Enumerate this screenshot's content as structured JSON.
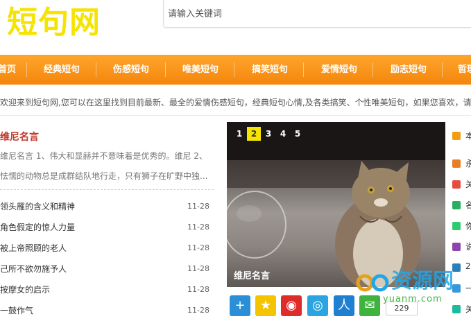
{
  "header": {
    "logo": "短句网",
    "search_placeholder": "请输入关键词"
  },
  "nav": {
    "items": [
      "首页",
      "经典短句",
      "伤感短句",
      "唯美短句",
      "搞笑短句",
      "爱情短句",
      "励志短句",
      "哲理"
    ]
  },
  "marquee": "欢迎来到短句网,您可以在这里找到目前最新、最全的爱情伤感短句，经典短句心情,及各类搞笑、个性唯美短句，如果您喜欢，请收",
  "featured": {
    "title": "维尼名言",
    "desc_line1": "维尼名言 1、伟大和显赫并不意味着是优秀的。维尼 2、",
    "desc_line2": "怯懦的动物总是成群结队地行走，只有狮子在旷野中独..."
  },
  "articles": [
    {
      "title": "领头雁的含义和精神",
      "date": "11-28"
    },
    {
      "title": "角色假定的惊人力量",
      "date": "11-28"
    },
    {
      "title": "被上帝照顾的老人",
      "date": "11-28"
    },
    {
      "title": "己所不欲勿施予人",
      "date": "11-28"
    },
    {
      "title": "按摩女的启示",
      "date": "11-28"
    },
    {
      "title": "一鼓作气",
      "date": "11-28"
    }
  ],
  "slider": {
    "pages": [
      "1",
      "2",
      "3",
      "4",
      "5"
    ],
    "active_page": "2",
    "caption": "维尼名言"
  },
  "share": {
    "count": "229",
    "icons": [
      "plus-icon",
      "qzone-star-icon",
      "weibo-icon",
      "tencent-weibo-icon",
      "renren-icon",
      "wechat-icon"
    ]
  },
  "right_list": {
    "items": [
      "本",
      "永",
      "关",
      "名",
      "你",
      "说",
      "2",
      "一",
      "关"
    ],
    "colors": [
      "#f39c12",
      "#e67e22",
      "#e74c3c",
      "#27ae60",
      "#2ecc71",
      "#8e44ad",
      "#2980b9",
      "#3498db",
      "#1abc9c"
    ]
  },
  "watermark": {
    "text": "资源网",
    "domain": "yuanm.com"
  },
  "colors": {
    "nav_bg": "#f4860c",
    "logo": "#f5e400",
    "accent": "#c0392b"
  }
}
